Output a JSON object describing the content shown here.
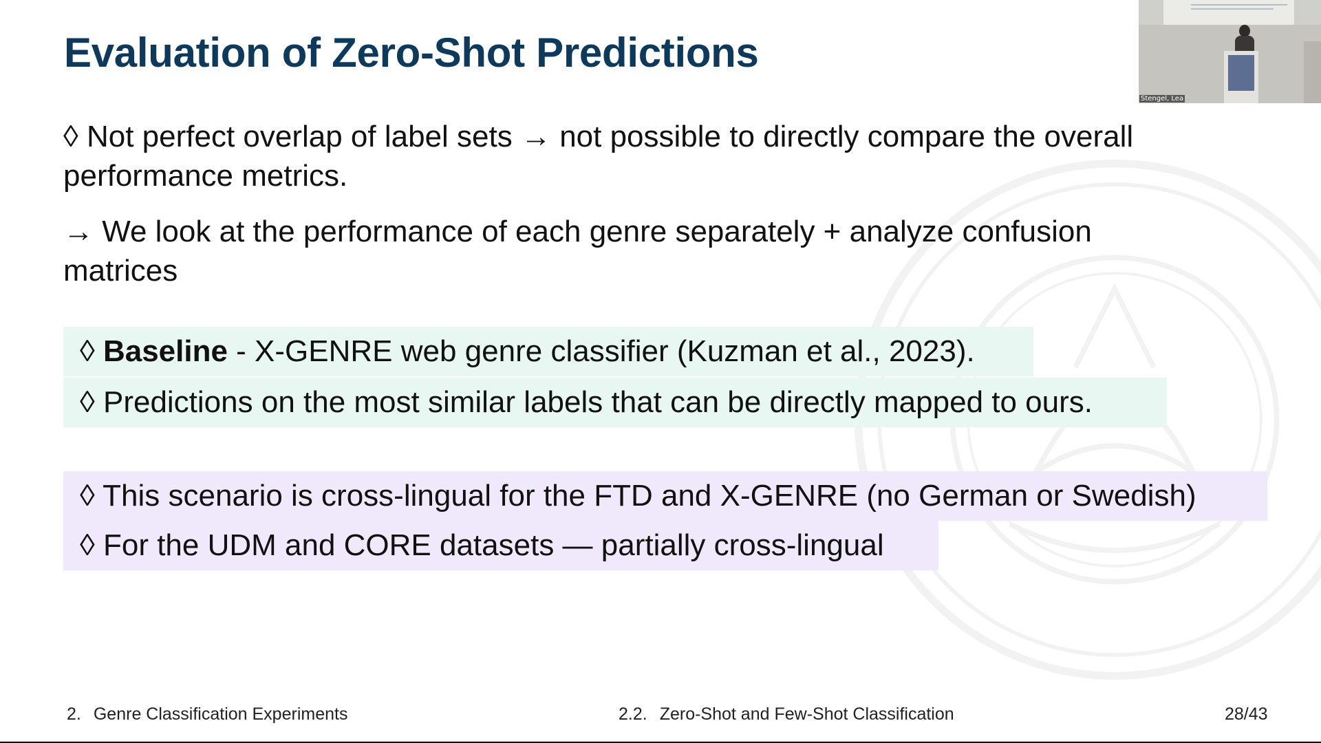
{
  "slide": {
    "title": "Evaluation of Zero-Shot Predictions",
    "point1": "◊ Not perfect overlap of label sets → not possible to directly compare the overall performance metrics.",
    "point2": "→ We look at the performance of each genre separately + analyze confusion matrices",
    "baseline": {
      "bullet": "◊ ",
      "label": "Baseline",
      "text": " - X-GENRE web genre classifier (Kuzman et al., 2023)."
    },
    "predictions": "◊ Predictions on the most similar labels that can be directly mapped to ours.",
    "crosslingual_1": "◊ This scenario is cross-lingual for the FTD and X-GENRE (no German or Swedish)",
    "crosslingual_2": "◊ For the UDM and CORE datasets — partially cross-lingual"
  },
  "footer": {
    "section_number": "2.",
    "section_title": "Genre Classification Experiments",
    "subsection_number": "2.2.",
    "subsection_title": "Zero-Shot and Few-Shot Classification",
    "page": "28/43"
  },
  "webcam": {
    "participant_name": "Stengel, Lea"
  },
  "colors": {
    "title": "#0d3a5c",
    "green_box": "#e8f7f1",
    "violet_box": "#f0e8fb"
  }
}
